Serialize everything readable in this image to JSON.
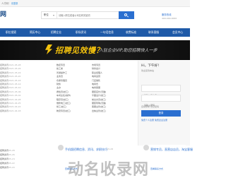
{
  "topbar": {
    "welcome": "人才网！",
    "login_link": "请登录"
  },
  "brand": {
    "logo": "网"
  },
  "search": {
    "category": "职位",
    "placeholder": "请输入职位或者公司名称关键词",
    "button": ""
  },
  "hotline": {
    "label": "服务热线",
    "number": "400-000-0000"
  },
  "nav": {
    "items": [
      "职位搜索",
      "简历中心",
      "招聘企业",
      "职场资讯",
      "一句话信息",
      "收费标准",
      "联系客服",
      "会员中心"
    ]
  },
  "banner": {
    "headline": "招聘见效慢？",
    "subtitle": "入驻企业VIP,助您招聘快人一步"
  },
  "col1": {
    "items": [
      {
        "text": "招聘资讯",
        "date": "2021-05-28"
      },
      {
        "text": "招聘资讯",
        "date": "2021-05-26"
      },
      {
        "text": "招聘资讯",
        "date": "2021-05-24"
      },
      {
        "text": "招聘资讯",
        "date": "2021-05-20"
      },
      {
        "text": "招聘资讯",
        "date": "2021-05-18"
      },
      {
        "text": "招聘资讯",
        "date": "2021-05-14"
      },
      {
        "text": "招聘资讯",
        "date": "2021-05-10"
      },
      {
        "text": "招聘资讯",
        "date": "2021-05-06"
      },
      {
        "text": "招聘资讯",
        "date": "2021-05-02"
      },
      {
        "text": "招聘资讯",
        "date": "2021-04-28"
      },
      {
        "text": "招聘资讯",
        "date": "2021-04-25"
      },
      {
        "text": "招聘资讯",
        "date": "2021-04-22"
      },
      {
        "text": "招聘资讯",
        "date": "2021-04-18"
      }
    ]
  },
  "col2": {
    "items": [
      "数控专员",
      "技工类",
      "普通操作工",
      "业务员",
      "仓库管理员",
      "财务",
      "主办",
      "质检员(技工)",
      "车间主任(操作)",
      "程序员(技工)",
      "维修电工(技工)",
      "焊工(技工)",
      "物流专员(技工)"
    ]
  },
  "col3": {
    "items": [
      "市场专员",
      "财务会计",
      "职业经理人",
      "电商运营",
      "门店销售",
      "电商仓",
      "电商客服",
      "服装店长(天猫)",
      "平面设计(技工)",
      "前台文员(技工)",
      "服装导购(天猫)",
      "客服主管(技工)",
      "出纳主管(技工)"
    ]
  },
  "loginbox": {
    "greeting": "Hi，下午好！",
    "welcome": "欢迎来到本站",
    "username_placeholder": "请输入用户名",
    "password_placeholder": "请输入密码",
    "remember": "自动登录 忘记密码",
    "submit": "登录",
    "register": "免费个人注册 免费企业注册"
  },
  "bottom_left": {
    "items": [
      {
        "text": "招聘资讯",
        "date": "05-28"
      },
      {
        "text": "招聘资讯",
        "date": "05-26"
      },
      {
        "text": "招聘资讯",
        "date": "05-24"
      },
      {
        "text": "招聘资讯",
        "date": "05-22"
      },
      {
        "text": "招聘资讯",
        "date": "05-20"
      }
    ]
  },
  "card1": {
    "title": "手机版招聘信息、资讯、求职技巧",
    "sub": "",
    "contact": "查看联系方式",
    "date": "05-28"
  },
  "card2": {
    "title": "营销专员，直营店店员，淘宝客服",
    "sub": "",
    "contact": "查看联系方式",
    "date": "05-28"
  },
  "watermark": {
    "text": "动名收录网"
  }
}
